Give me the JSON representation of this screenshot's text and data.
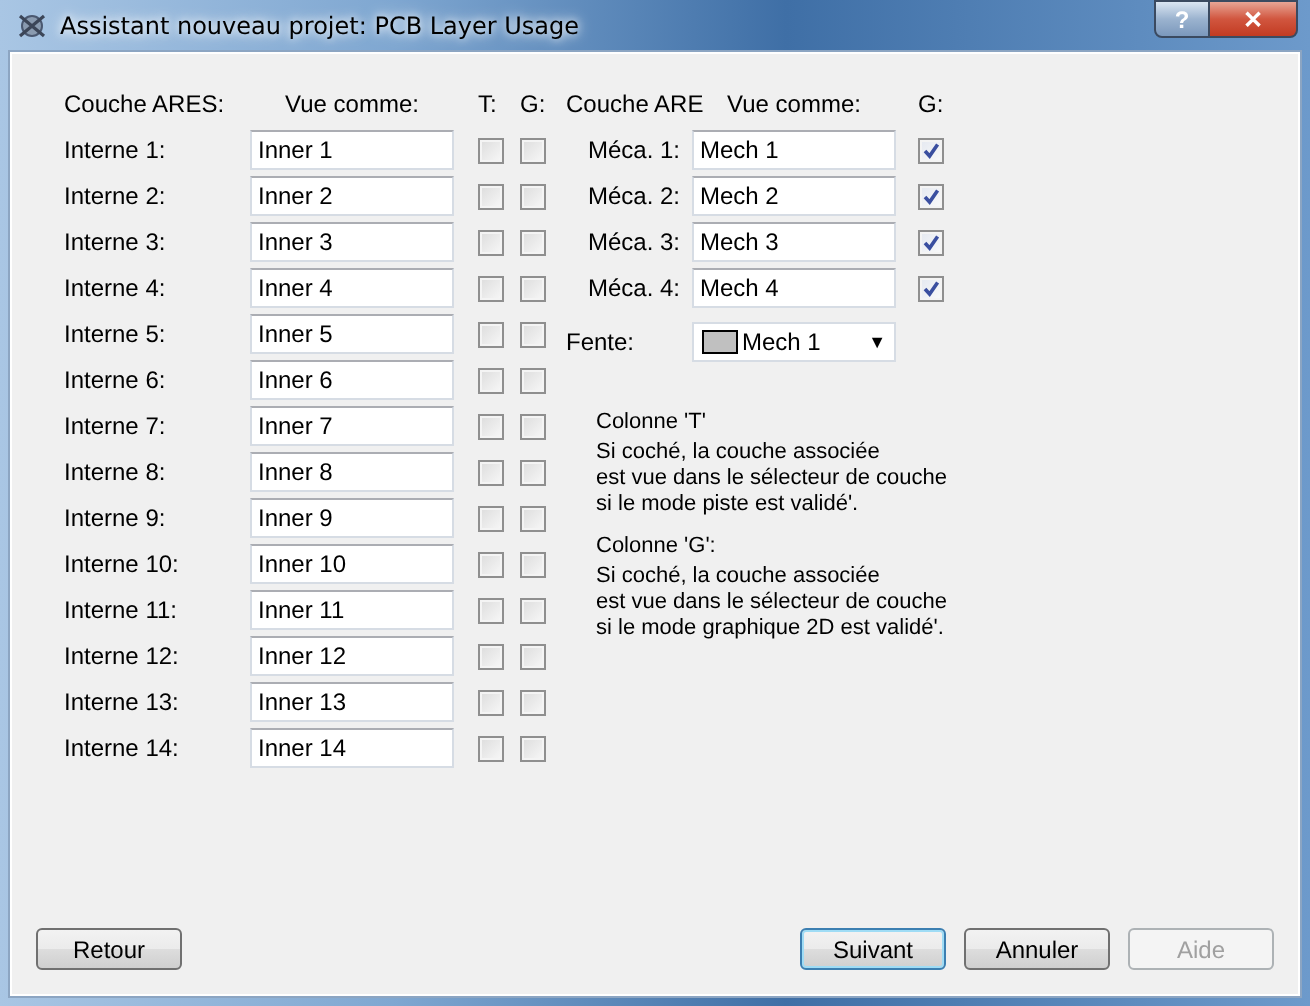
{
  "window": {
    "title": "Assistant nouveau projet: PCB Layer Usage",
    "title_buttons": [
      {
        "kind": "help",
        "label": "?"
      },
      {
        "kind": "close",
        "label": "✕"
      }
    ]
  },
  "internal": {
    "headers": [
      "Couche ARES:",
      "Vue comme:",
      "T:",
      "G:"
    ],
    "rows": [
      {
        "label": "Interne 1:",
        "value": "Inner 1",
        "t_checked": false,
        "g_checked": false
      },
      {
        "label": "Interne 2:",
        "value": "Inner 2",
        "t_checked": false,
        "g_checked": false
      },
      {
        "label": "Interne 3:",
        "value": "Inner 3",
        "t_checked": false,
        "g_checked": false
      },
      {
        "label": "Interne 4:",
        "value": "Inner 4",
        "t_checked": false,
        "g_checked": false
      },
      {
        "label": "Interne 5:",
        "value": "Inner 5",
        "t_checked": false,
        "g_checked": false
      },
      {
        "label": "Interne 6:",
        "value": "Inner 6",
        "t_checked": false,
        "g_checked": false
      },
      {
        "label": "Interne 7:",
        "value": "Inner 7",
        "t_checked": false,
        "g_checked": false
      },
      {
        "label": "Interne 8:",
        "value": "Inner 8",
        "t_checked": false,
        "g_checked": false
      },
      {
        "label": "Interne 9:",
        "value": "Inner 9",
        "t_checked": false,
        "g_checked": false
      },
      {
        "label": "Interne 10:",
        "value": "Inner 10",
        "t_checked": false,
        "g_checked": false
      },
      {
        "label": "Interne 11:",
        "value": "Inner 11",
        "t_checked": false,
        "g_checked": false
      },
      {
        "label": "Interne 12:",
        "value": "Inner 12",
        "t_checked": false,
        "g_checked": false
      },
      {
        "label": "Interne 13:",
        "value": "Inner 13",
        "t_checked": false,
        "g_checked": false
      },
      {
        "label": "Interne 14:",
        "value": "Inner 14",
        "t_checked": false,
        "g_checked": false
      }
    ]
  },
  "mechanical": {
    "headers": [
      "Couche ARE",
      "Vue comme:",
      "G:"
    ],
    "rows": [
      {
        "label": "Méca. 1:",
        "value": "Mech 1",
        "g_checked": true
      },
      {
        "label": "Méca. 2:",
        "value": "Mech 2",
        "g_checked": true
      },
      {
        "label": "Méca. 3:",
        "value": "Mech 3",
        "g_checked": true
      },
      {
        "label": "Méca. 4:",
        "value": "Mech 4",
        "g_checked": true
      }
    ],
    "slot": {
      "label": "Fente:",
      "value": "Mech 1",
      "color": "#c0c0c0",
      "arrow": "▼"
    }
  },
  "help": [
    {
      "heading": "Colonne 'T'",
      "lines": [
        "Si coché, la couche associée",
        "est vue dans le sélecteur de couche",
        "si le mode piste est validé'."
      ]
    },
    {
      "heading": "Colonne 'G':",
      "lines": [
        "Si coché, la couche associée",
        "est vue dans le sélecteur de couche",
        "si le mode graphique 2D est validé'."
      ]
    }
  ],
  "buttons": [
    {
      "label": "Retour",
      "default": false,
      "disabled": false
    },
    {
      "label": "Suivant",
      "default": true,
      "disabled": false
    },
    {
      "label": "Annuler",
      "default": false,
      "disabled": false
    },
    {
      "label": "Aide",
      "default": false,
      "disabled": true
    }
  ]
}
